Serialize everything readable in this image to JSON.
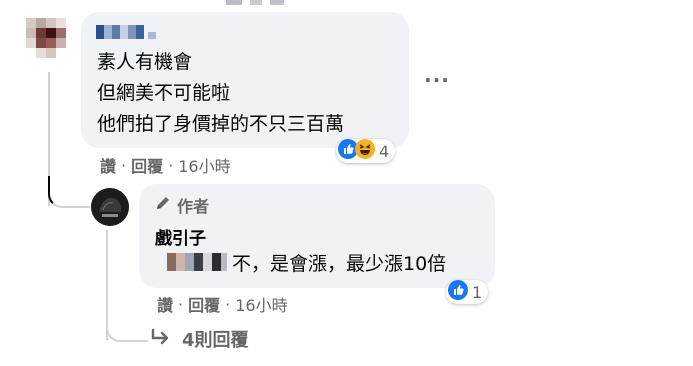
{
  "comment": {
    "lines": [
      "素人有機會",
      "但網美不可能啦",
      "他們拍了身價掉的不只三百萬"
    ],
    "actions": {
      "like": "讚",
      "reply": "回覆",
      "time": "16小時"
    },
    "reactions": {
      "icons": [
        "like-icon",
        "haha-icon"
      ],
      "count": "4"
    }
  },
  "reply": {
    "author_badge": "作者",
    "author_name": "戲引子",
    "text": "不，是會漲，最少漲10倍",
    "actions": {
      "like": "讚",
      "reply": "回覆",
      "time": "16小時"
    },
    "reactions": {
      "icons": [
        "like-icon"
      ],
      "count": "1"
    }
  },
  "more_replies": {
    "label": "4則回覆"
  },
  "colors": {
    "like_blue": "#1877f2",
    "haha_yellow": "#f7b125",
    "bubble_bg": "#f0f2f5",
    "meta_gray": "#65676b"
  }
}
